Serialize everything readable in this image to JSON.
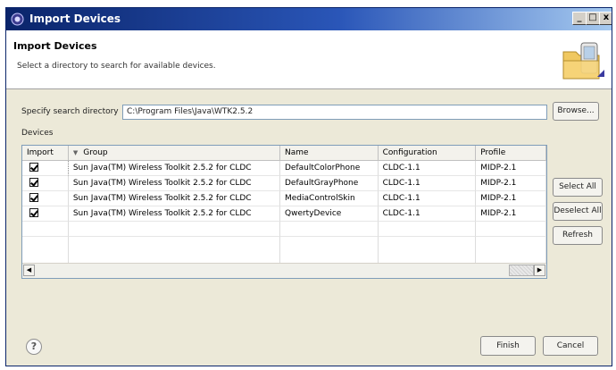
{
  "window": {
    "title": "Import Devices",
    "controls": {
      "minimize": "_",
      "maximize": "□",
      "close": "x"
    }
  },
  "header": {
    "title": "Import Devices",
    "description": "Select a directory to search for available devices."
  },
  "directory": {
    "label": "Specify search directory",
    "value": "C:\\Program Files\\Java\\WTK2.5.2",
    "browse_label": "Browse..."
  },
  "devices": {
    "label": "Devices",
    "columns": [
      "Import",
      "Group",
      "Name",
      "Configuration",
      "Profile"
    ],
    "sort_indicator": "▼",
    "rows": [
      {
        "checked": true,
        "group": "Sun Java(TM) Wireless Toolkit 2.5.2 for CLDC",
        "name": "DefaultColorPhone",
        "configuration": "CLDC-1.1",
        "profile": "MIDP-2.1"
      },
      {
        "checked": true,
        "group": "Sun Java(TM) Wireless Toolkit 2.5.2 for CLDC",
        "name": "DefaultGrayPhone",
        "configuration": "CLDC-1.1",
        "profile": "MIDP-2.1"
      },
      {
        "checked": true,
        "group": "Sun Java(TM) Wireless Toolkit 2.5.2 for CLDC",
        "name": "MediaControlSkin",
        "configuration": "CLDC-1.1",
        "profile": "MIDP-2.1"
      },
      {
        "checked": true,
        "group": "Sun Java(TM) Wireless Toolkit 2.5.2 for CLDC",
        "name": "QwertyDevice",
        "configuration": "CLDC-1.1",
        "profile": "MIDP-2.1"
      }
    ]
  },
  "side_buttons": {
    "select_all": "Select All",
    "deselect_all": "Deselect All",
    "refresh": "Refresh"
  },
  "footer": {
    "help": "?",
    "finish": "Finish",
    "cancel": "Cancel"
  }
}
